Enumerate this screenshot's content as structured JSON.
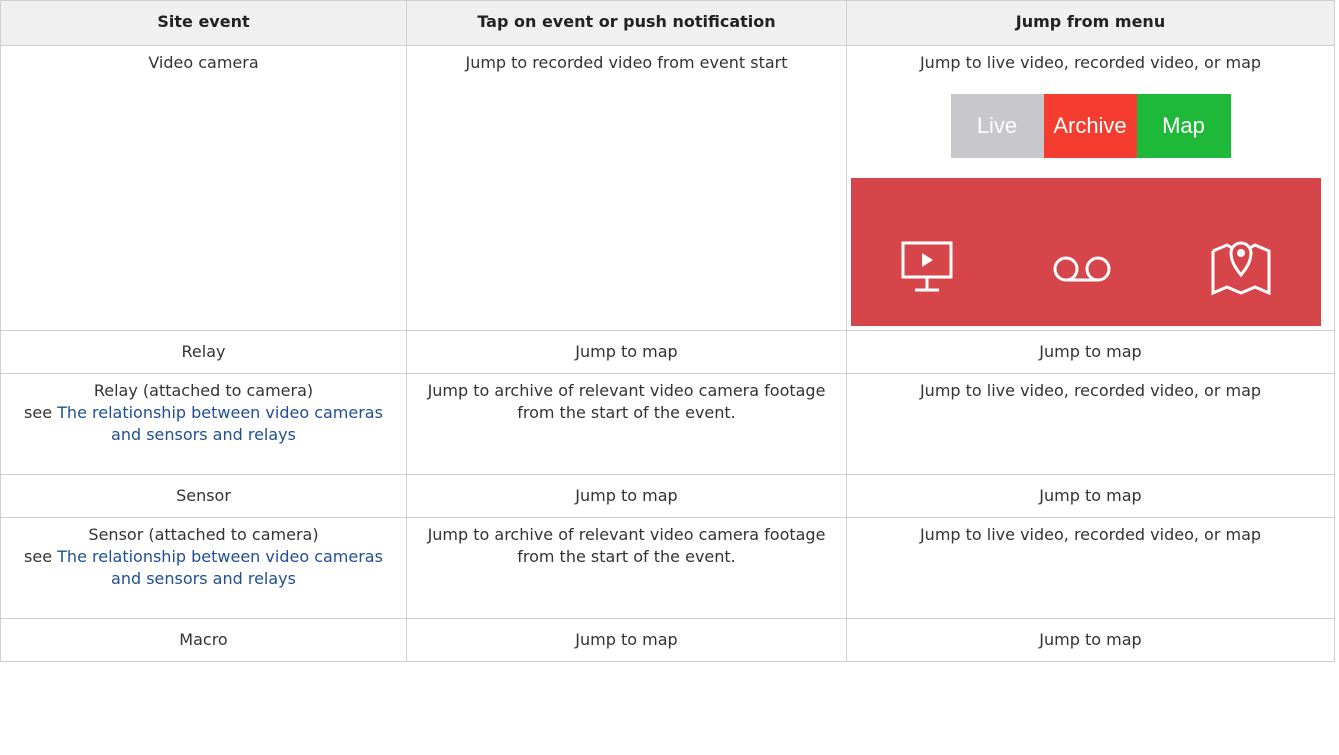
{
  "table": {
    "headers": [
      "Site event",
      "Tap on event or push notification",
      "Jump from menu"
    ],
    "rows": [
      {
        "event": "Video camera",
        "tap": "Jump to recorded video from event start",
        "menu": "Jump to live video, recorded video, or map",
        "segment": {
          "live": "Live",
          "archive": "Archive",
          "map": "Map"
        },
        "icons": [
          "monitor-play-icon",
          "voicemail-archive-icon",
          "map-pin-icon"
        ]
      },
      {
        "event": "Relay",
        "tap": "Jump to map",
        "menu": "Jump to map"
      },
      {
        "event": "Relay (attached to camera)",
        "see": "see",
        "link": "The relationship between video cameras and sensors and relays",
        "tap": "Jump to archive of relevant video camera footage from the start of the event.",
        "menu": "Jump to live video, recorded video, or map"
      },
      {
        "event": "Sensor",
        "tap": "Jump to map",
        "menu": "Jump to map"
      },
      {
        "event": "Sensor (attached to camera)",
        "see": "see",
        "link": "The relationship between video cameras and sensors and relays",
        "tap": "Jump to archive of relevant video camera footage from the start of the event.",
        "menu": "Jump to live video, recorded video, or map"
      },
      {
        "event": "Macro",
        "tap": "Jump to map",
        "menu": "Jump to map"
      }
    ]
  },
  "colors": {
    "link": "#1f4e96",
    "header_bg": "#f0f0f0",
    "live": "#c7c7cc",
    "archive": "#f53d2f",
    "map": "#1fb93a",
    "icon_bar": "#d64549"
  }
}
